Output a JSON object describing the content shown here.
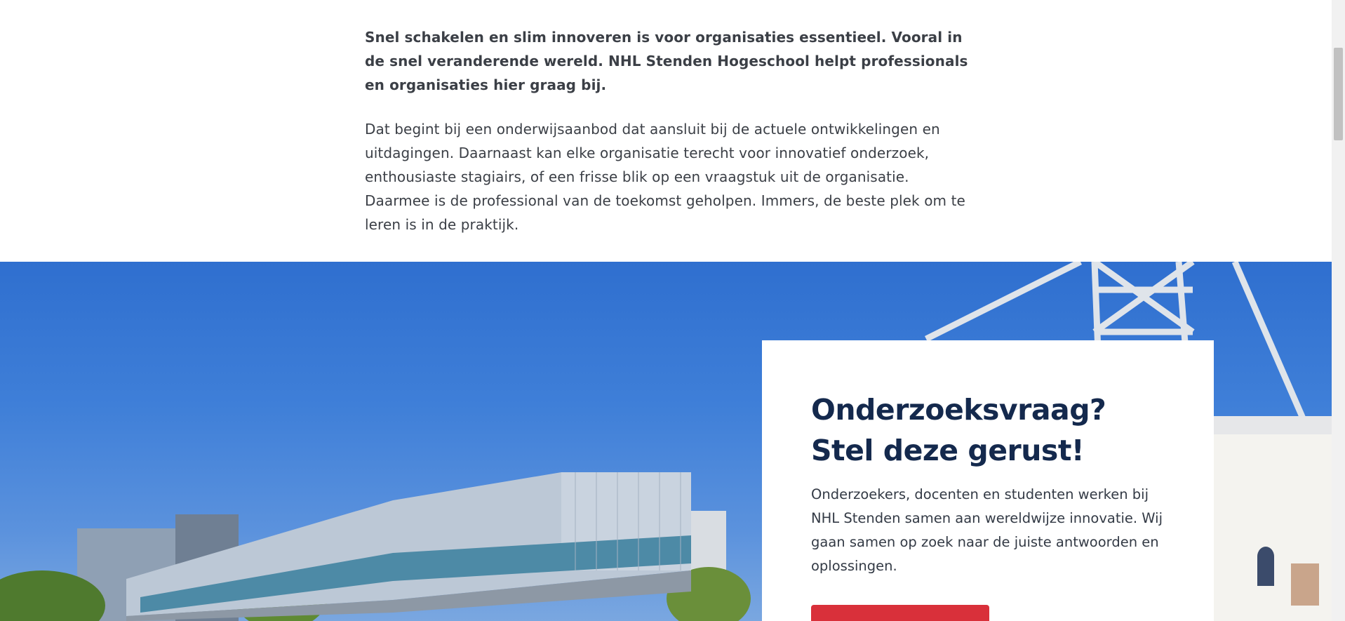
{
  "intro": {
    "lead": "Snel schakelen en slim innoveren is voor organisaties essentieel. Vooral in de snel veranderende wereld. NHL Stenden Hogeschool helpt professionals en organisaties hier graag bij.",
    "body": "Dat begint bij een onderwijsaanbod dat aansluit bij de actuele ontwikkelingen en uitdagingen. Daarnaast kan elke organisatie terecht voor innovatief onderzoek, enthousiaste stagiairs, of een frisse blik op een vraagstuk uit de organisatie. Daarmee is de professional van de toekomst geholpen. Immers, de beste plek om te leren is in de praktijk."
  },
  "card": {
    "title": "Onderzoeksvraag? Stel deze gerust!",
    "text": "Onderzoekers, docenten en studenten werken bij NHL Stenden samen aan wereldwijze innovatie. Wij gaan samen op zoek naar de juiste antwoorden en oplossingen.",
    "cta_label": ""
  },
  "colors": {
    "title": "#14294d",
    "text": "#333a45",
    "cta": "#d9303a",
    "sky": "#3f7fd8"
  },
  "hero": {
    "image": "campus-building-photo"
  }
}
